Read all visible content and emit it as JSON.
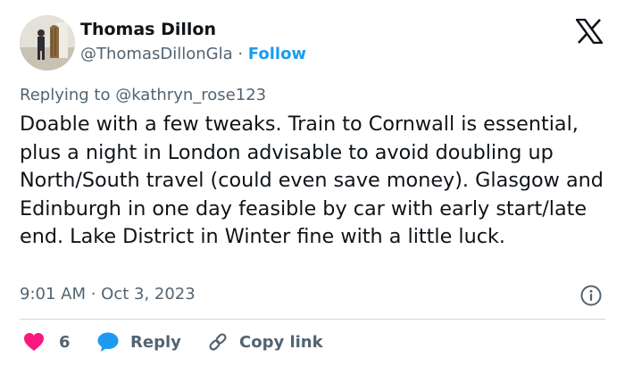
{
  "author": {
    "display_name": "Thomas Dillon",
    "handle": "@ThomasDillonGla",
    "separator": " · ",
    "follow_label": "Follow"
  },
  "tweet": {
    "replying_to_prefix": "Replying to ",
    "replying_to_handle": "@kathryn_rose123",
    "text": "Doable with a few tweaks. Train to Cornwall is essential, plus a night in London advisable to avoid doubling up North/South travel (could even save money). Glasgow and Edinburgh in one day feasible by car with early start/late end. Lake District in Winter fine with a little luck.",
    "timestamp": "9:01 AM · Oct 3, 2023"
  },
  "actions": {
    "like_count": "6",
    "reply_label": "Reply",
    "copy_link_label": "Copy link"
  },
  "colors": {
    "accent_blue": "#1d9bf0",
    "like_red": "#f91880",
    "muted_gray": "#536471",
    "text_dark": "#0f1419"
  },
  "icons": [
    "x-logo-icon",
    "info-icon",
    "heart-icon",
    "reply-bubble-icon",
    "link-icon"
  ]
}
